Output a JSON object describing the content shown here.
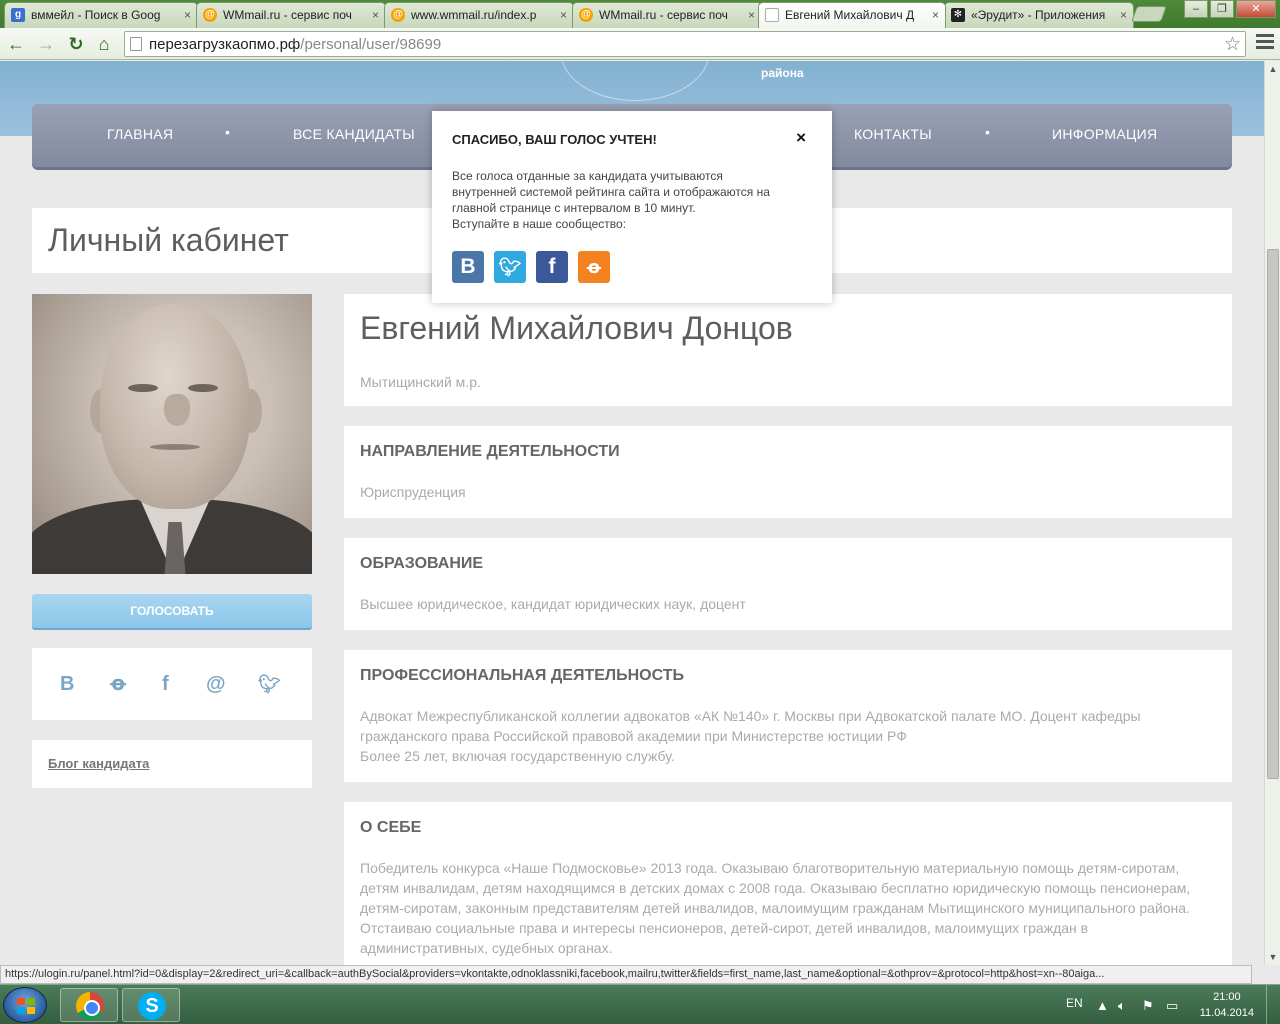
{
  "browser": {
    "tabs": [
      {
        "label": "вммейл - Поиск в Goog",
        "icon": "google-icon",
        "active": false
      },
      {
        "label": "WMmail.ru - сервис поч",
        "icon": "wmmail-icon",
        "active": false
      },
      {
        "label": "www.wmmail.ru/index.p",
        "icon": "wmmail-icon",
        "active": false
      },
      {
        "label": "WMmail.ru - сервис поч",
        "icon": "wmmail-icon",
        "active": false
      },
      {
        "label": "Евгений Михайлович Д",
        "icon": "page-icon",
        "active": true
      },
      {
        "label": "«Эрудит» - Приложения",
        "icon": "snowflake-icon",
        "active": false
      }
    ],
    "url_host": "перезагрузкаопмо.рф",
    "url_path": "/personal/user/98699"
  },
  "site": {
    "hero_caption": "района",
    "nav": [
      {
        "label": "ГЛАВНАЯ"
      },
      {
        "label": "ВСЕ КАНДИДАТЫ"
      },
      {
        "label": "КОНТАКТЫ"
      },
      {
        "label": "ИНФОРМАЦИЯ"
      }
    ],
    "page_title": "Личный кабинет",
    "vote_button": "ГОЛОСОВАТЬ",
    "social_icons": [
      "vk-icon",
      "odnoklassniki-icon",
      "facebook-icon",
      "mail-icon",
      "twitter-icon"
    ],
    "blog_link": "Блог кандидата"
  },
  "candidate": {
    "name": "Евгений Михайлович Донцов",
    "district": "Мытищинский м.р.",
    "sections": [
      {
        "heading": "НАПРАВЛЕНИЕ ДЕЯТЕЛЬНОСТИ",
        "text": "Юриспруденция"
      },
      {
        "heading": "ОБРАЗОВАНИЕ",
        "text": "Высшее юридическое, кандидат юридических наук, доцент"
      },
      {
        "heading": "ПРОФЕССИОНАЛЬНАЯ ДЕЯТЕЛЬНОСТЬ",
        "lines": [
          "Адвокат Межреспубликанской коллегии адвокатов «АК №140» г. Москвы при Адвокатской палате МО. Доцент кафедры",
          "гражданского права Российской правовой академии при Министерстве юстиции РФ",
          "Более 25 лет, включая государственную службу."
        ]
      },
      {
        "heading": "О СЕБЕ",
        "lines": [
          "Победитель конкурса «Наше Подмосковье» 2013 года. Оказываю благотворительную материальную помощь детям-сиротам,",
          "детям инвалидам, детям находящимся в детских домах с 2008 года. Оказываю бесплатно юридическую помощь пенсионерам,",
          "детям-сиротам, законным представителям детей инвалидов, малоимущим гражданам Мытищинского муниципального района.",
          "Отстаиваю социальные права и интересы пенсионеров, детей-сирот, детей инвалидов, малоимущих граждан в",
          "административных, судебных органах."
        ]
      }
    ]
  },
  "popup": {
    "title": "СПАСИБО, ВАШ ГОЛОС УЧТЕН!",
    "close": "×",
    "body_lines": [
      "Все голоса отданные за кандидата учитываются",
      "внутренней системой рейтинга сайта и отображаются на",
      "главной странице с интервалом в 10 минут.",
      "Вступайте в наше сообщество:"
    ],
    "social": [
      {
        "icon": "vk-icon",
        "glyph": "B",
        "color": "#4a76a8"
      },
      {
        "icon": "twitter-icon",
        "glyph": "t",
        "color": "#2fa9e0"
      },
      {
        "icon": "facebook-icon",
        "glyph": "f",
        "color": "#3b5998"
      },
      {
        "icon": "odnoklassniki-icon",
        "glyph": "ok",
        "color": "#f58220"
      }
    ]
  },
  "status_bar": "https://ulogin.ru/panel.html?id=0&display=2&redirect_uri=&callback=authBySocial&providers=vkontakte,odnoklassniki,facebook,mailru,twitter&fields=first_name,last_name&optional=&othprov=&protocol=http&host=xn--80aiga...",
  "taskbar": {
    "lang": "EN",
    "time": "21:00",
    "date": "11.04.2014"
  }
}
